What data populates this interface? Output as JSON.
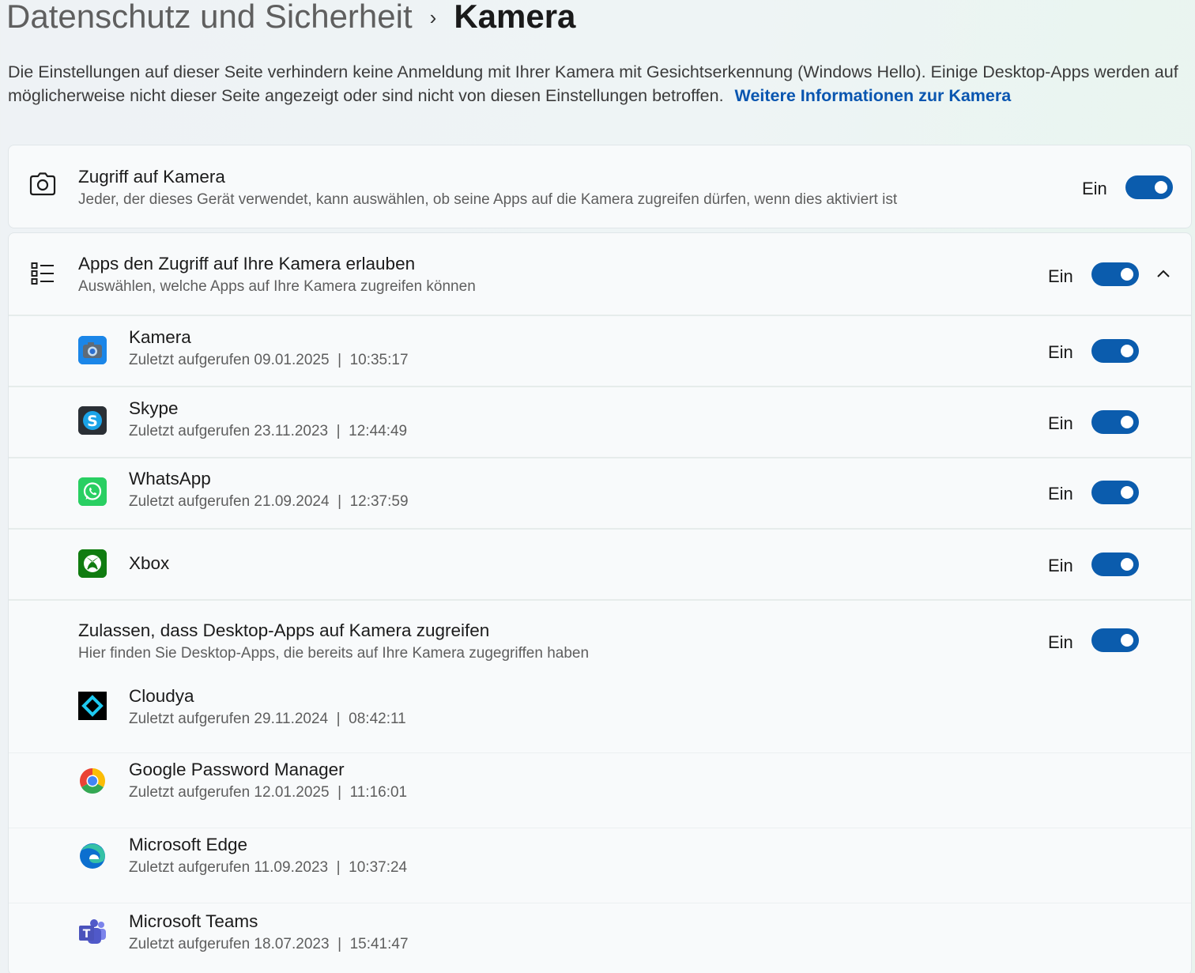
{
  "breadcrumb": {
    "parent": "Datenschutz und Sicherheit",
    "separator": "›",
    "current": "Kamera"
  },
  "intro": {
    "text": "Die Einstellungen auf dieser Seite verhindern keine Anmeldung mit Ihrer Kamera mit Gesichtserkennung (Windows Hello). Einige Desktop-Apps werden auf möglicherweise nicht dieser Seite angezeigt oder sind nicht von diesen Einstellungen betroffen.",
    "link": "Weitere Informationen zur Kamera"
  },
  "camera_access": {
    "title": "Zugriff auf Kamera",
    "subtitle": "Jeder, der dieses Gerät verwendet, kann auswählen, ob seine Apps auf die Kamera zugreifen dürfen, wenn dies aktiviert ist",
    "state": "Ein",
    "on": true,
    "icon": "camera-icon"
  },
  "apps_access": {
    "title": "Apps den Zugriff auf Ihre Kamera erlauben",
    "subtitle": "Auswählen, welche Apps auf Ihre Kamera zugreifen können",
    "state": "Ein",
    "on": true,
    "icon": "list-icon",
    "expanded": true,
    "apps": [
      {
        "name": "Kamera",
        "last": "Zuletzt aufgerufen 09.01.2025  |  10:35:17",
        "state": "Ein",
        "on": true,
        "icon": "camera-app-icon"
      },
      {
        "name": "Skype",
        "last": "Zuletzt aufgerufen 23.11.2023  |  12:44:49",
        "state": "Ein",
        "on": true,
        "icon": "skype-icon"
      },
      {
        "name": "WhatsApp",
        "last": "Zuletzt aufgerufen 21.09.2024  |  12:37:59",
        "state": "Ein",
        "on": true,
        "icon": "whatsapp-icon"
      },
      {
        "name": "Xbox",
        "last": "",
        "state": "Ein",
        "on": true,
        "icon": "xbox-icon"
      }
    ]
  },
  "desktop_apps": {
    "title": "Zulassen, dass Desktop-Apps auf Kamera zugreifen",
    "subtitle": "Hier finden Sie Desktop-Apps, die bereits auf Ihre Kamera zugegriffen haben",
    "state": "Ein",
    "on": true,
    "apps": [
      {
        "name": "Cloudya",
        "last": "Zuletzt aufgerufen 29.11.2024  |  08:42:11",
        "icon": "cloudya-icon"
      },
      {
        "name": "Google Password Manager",
        "last": "Zuletzt aufgerufen 12.01.2025  |  11:16:01",
        "icon": "chrome-icon"
      },
      {
        "name": "Microsoft Edge",
        "last": "Zuletzt aufgerufen 11.09.2023  |  10:37:24",
        "icon": "edge-icon"
      },
      {
        "name": "Microsoft Teams",
        "last": "Zuletzt aufgerufen 18.07.2023  |  15:41:47",
        "icon": "teams-icon"
      }
    ]
  },
  "colors": {
    "accent": "#0b5cad",
    "link": "#0a56b0"
  }
}
